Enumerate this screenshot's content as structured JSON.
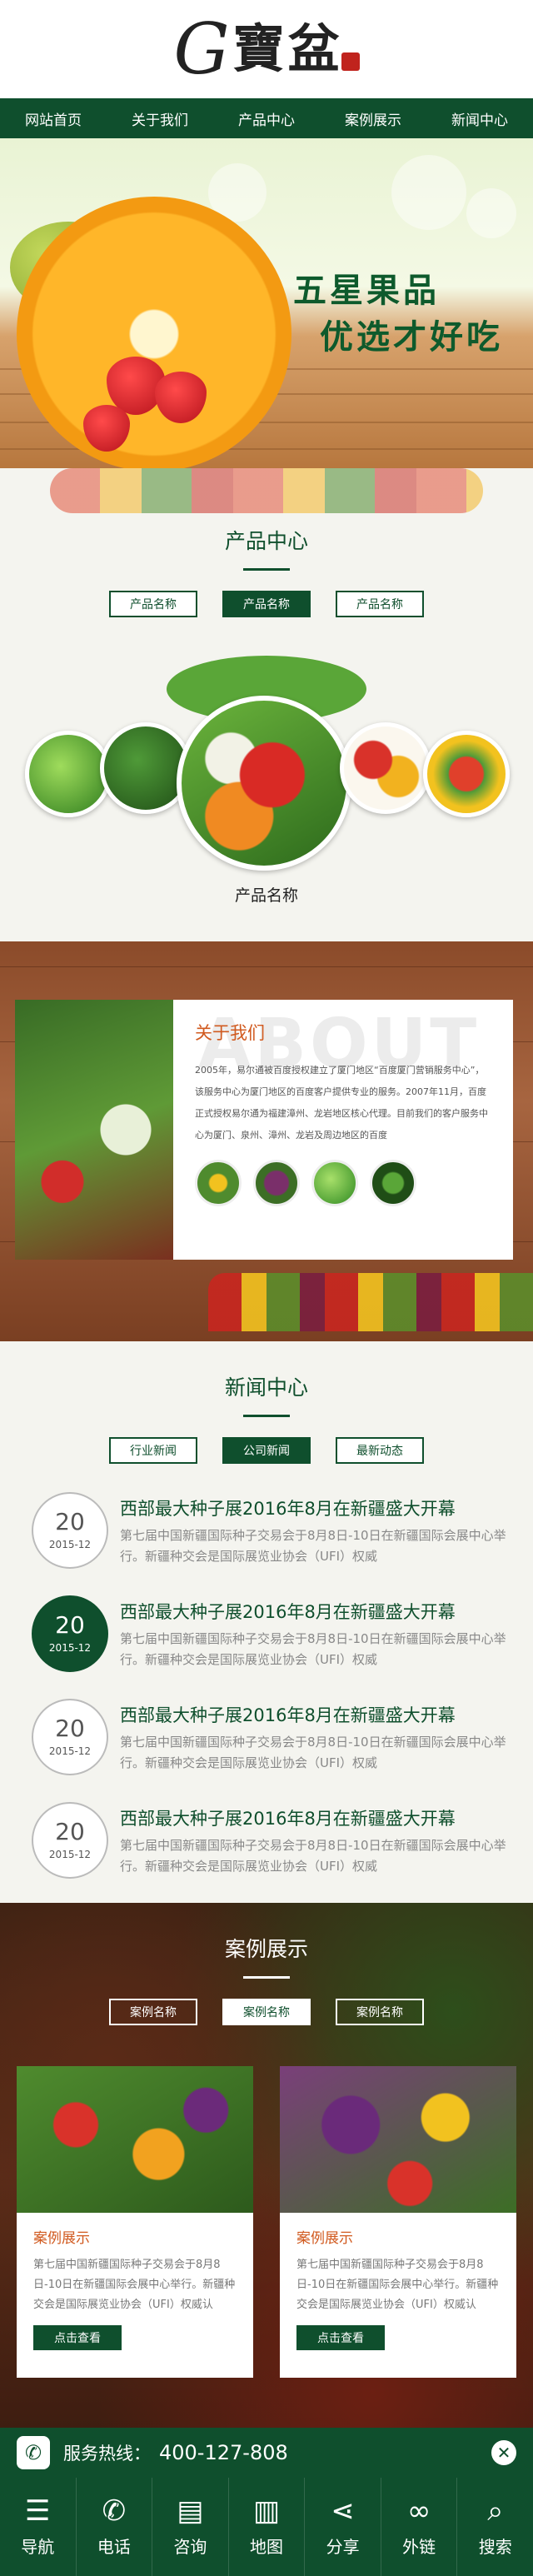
{
  "brand": {
    "logo_g": "G",
    "logo_text": "寶盆"
  },
  "nav": [
    "网站首页",
    "关于我们",
    "产品中心",
    "案例展示",
    "新闻中心"
  ],
  "banner": {
    "line1": "五星果品",
    "line2": "优选才好吃"
  },
  "products": {
    "title": "产品中心",
    "tabs": [
      "产品名称",
      "产品名称",
      "产品名称"
    ],
    "active_tab": 1,
    "caption": "产品名称"
  },
  "about": {
    "bg_word": "ABOUT",
    "title": "关于我们",
    "text": "2005年，易尔通被百度授权建立了厦门地区“百度厦门营销服务中心”，该服务中心为厦门地区的百度客户提供专业的服务。2007年11月，百度正式授权易尔通为福建漳州、龙岩地区核心代理。目前我们的客户服务中心为厦门、泉州、漳州、龙岩及周边地区的百度"
  },
  "news": {
    "title": "新闻中心",
    "tabs": [
      "行业新闻",
      "公司新闻",
      "最新动态"
    ],
    "active_tab": 1,
    "items": [
      {
        "day": "20",
        "month": "2015-12",
        "title": "西部最大种子展2016年8月在新疆盛大开幕",
        "desc": "第七届中国新疆国际种子交易会于8月8日-10日在新疆国际会展中心举行。新疆种交会是国际展览业协会（UFI）权威",
        "active": false
      },
      {
        "day": "20",
        "month": "2015-12",
        "title": "西部最大种子展2016年8月在新疆盛大开幕",
        "desc": "第七届中国新疆国际种子交易会于8月8日-10日在新疆国际会展中心举行。新疆种交会是国际展览业协会（UFI）权威",
        "active": true
      },
      {
        "day": "20",
        "month": "2015-12",
        "title": "西部最大种子展2016年8月在新疆盛大开幕",
        "desc": "第七届中国新疆国际种子交易会于8月8日-10日在新疆国际会展中心举行。新疆种交会是国际展览业协会（UFI）权威",
        "active": false
      },
      {
        "day": "20",
        "month": "2015-12",
        "title": "西部最大种子展2016年8月在新疆盛大开幕",
        "desc": "第七届中国新疆国际种子交易会于8月8日-10日在新疆国际会展中心举行。新疆种交会是国际展览业协会（UFI）权威",
        "active": false
      }
    ]
  },
  "cases": {
    "title": "案例展示",
    "tabs": [
      "案例名称",
      "案例名称",
      "案例名称"
    ],
    "active_tab": 1,
    "cards": [
      {
        "title": "案例展示",
        "desc": "第七届中国新疆国际种子交易会于8月8日-10日在新疆国际会展中心举行。新疆种交会是国际展览业协会（UFI）权威认",
        "button": "点击查看"
      },
      {
        "title": "案例展示",
        "desc": "第七届中国新疆国际种子交易会于8月8日-10日在新疆国际会展中心举行。新疆种交会是国际展览业协会（UFI）权威认",
        "button": "点击查看"
      }
    ]
  },
  "hotline": {
    "label": "服务热线：",
    "number": "400-127-808"
  },
  "bottom_bar": [
    {
      "label": "导航",
      "icon": "menu-icon"
    },
    {
      "label": "电话",
      "icon": "phone-icon"
    },
    {
      "label": "咨询",
      "icon": "chat-icon"
    },
    {
      "label": "地图",
      "icon": "map-icon"
    },
    {
      "label": "分享",
      "icon": "share-icon"
    },
    {
      "label": "外链",
      "icon": "link-icon"
    },
    {
      "label": "搜索",
      "icon": "search-icon"
    }
  ],
  "colors": {
    "primary": "#0f4f2d",
    "accent": "#d15a1f"
  }
}
